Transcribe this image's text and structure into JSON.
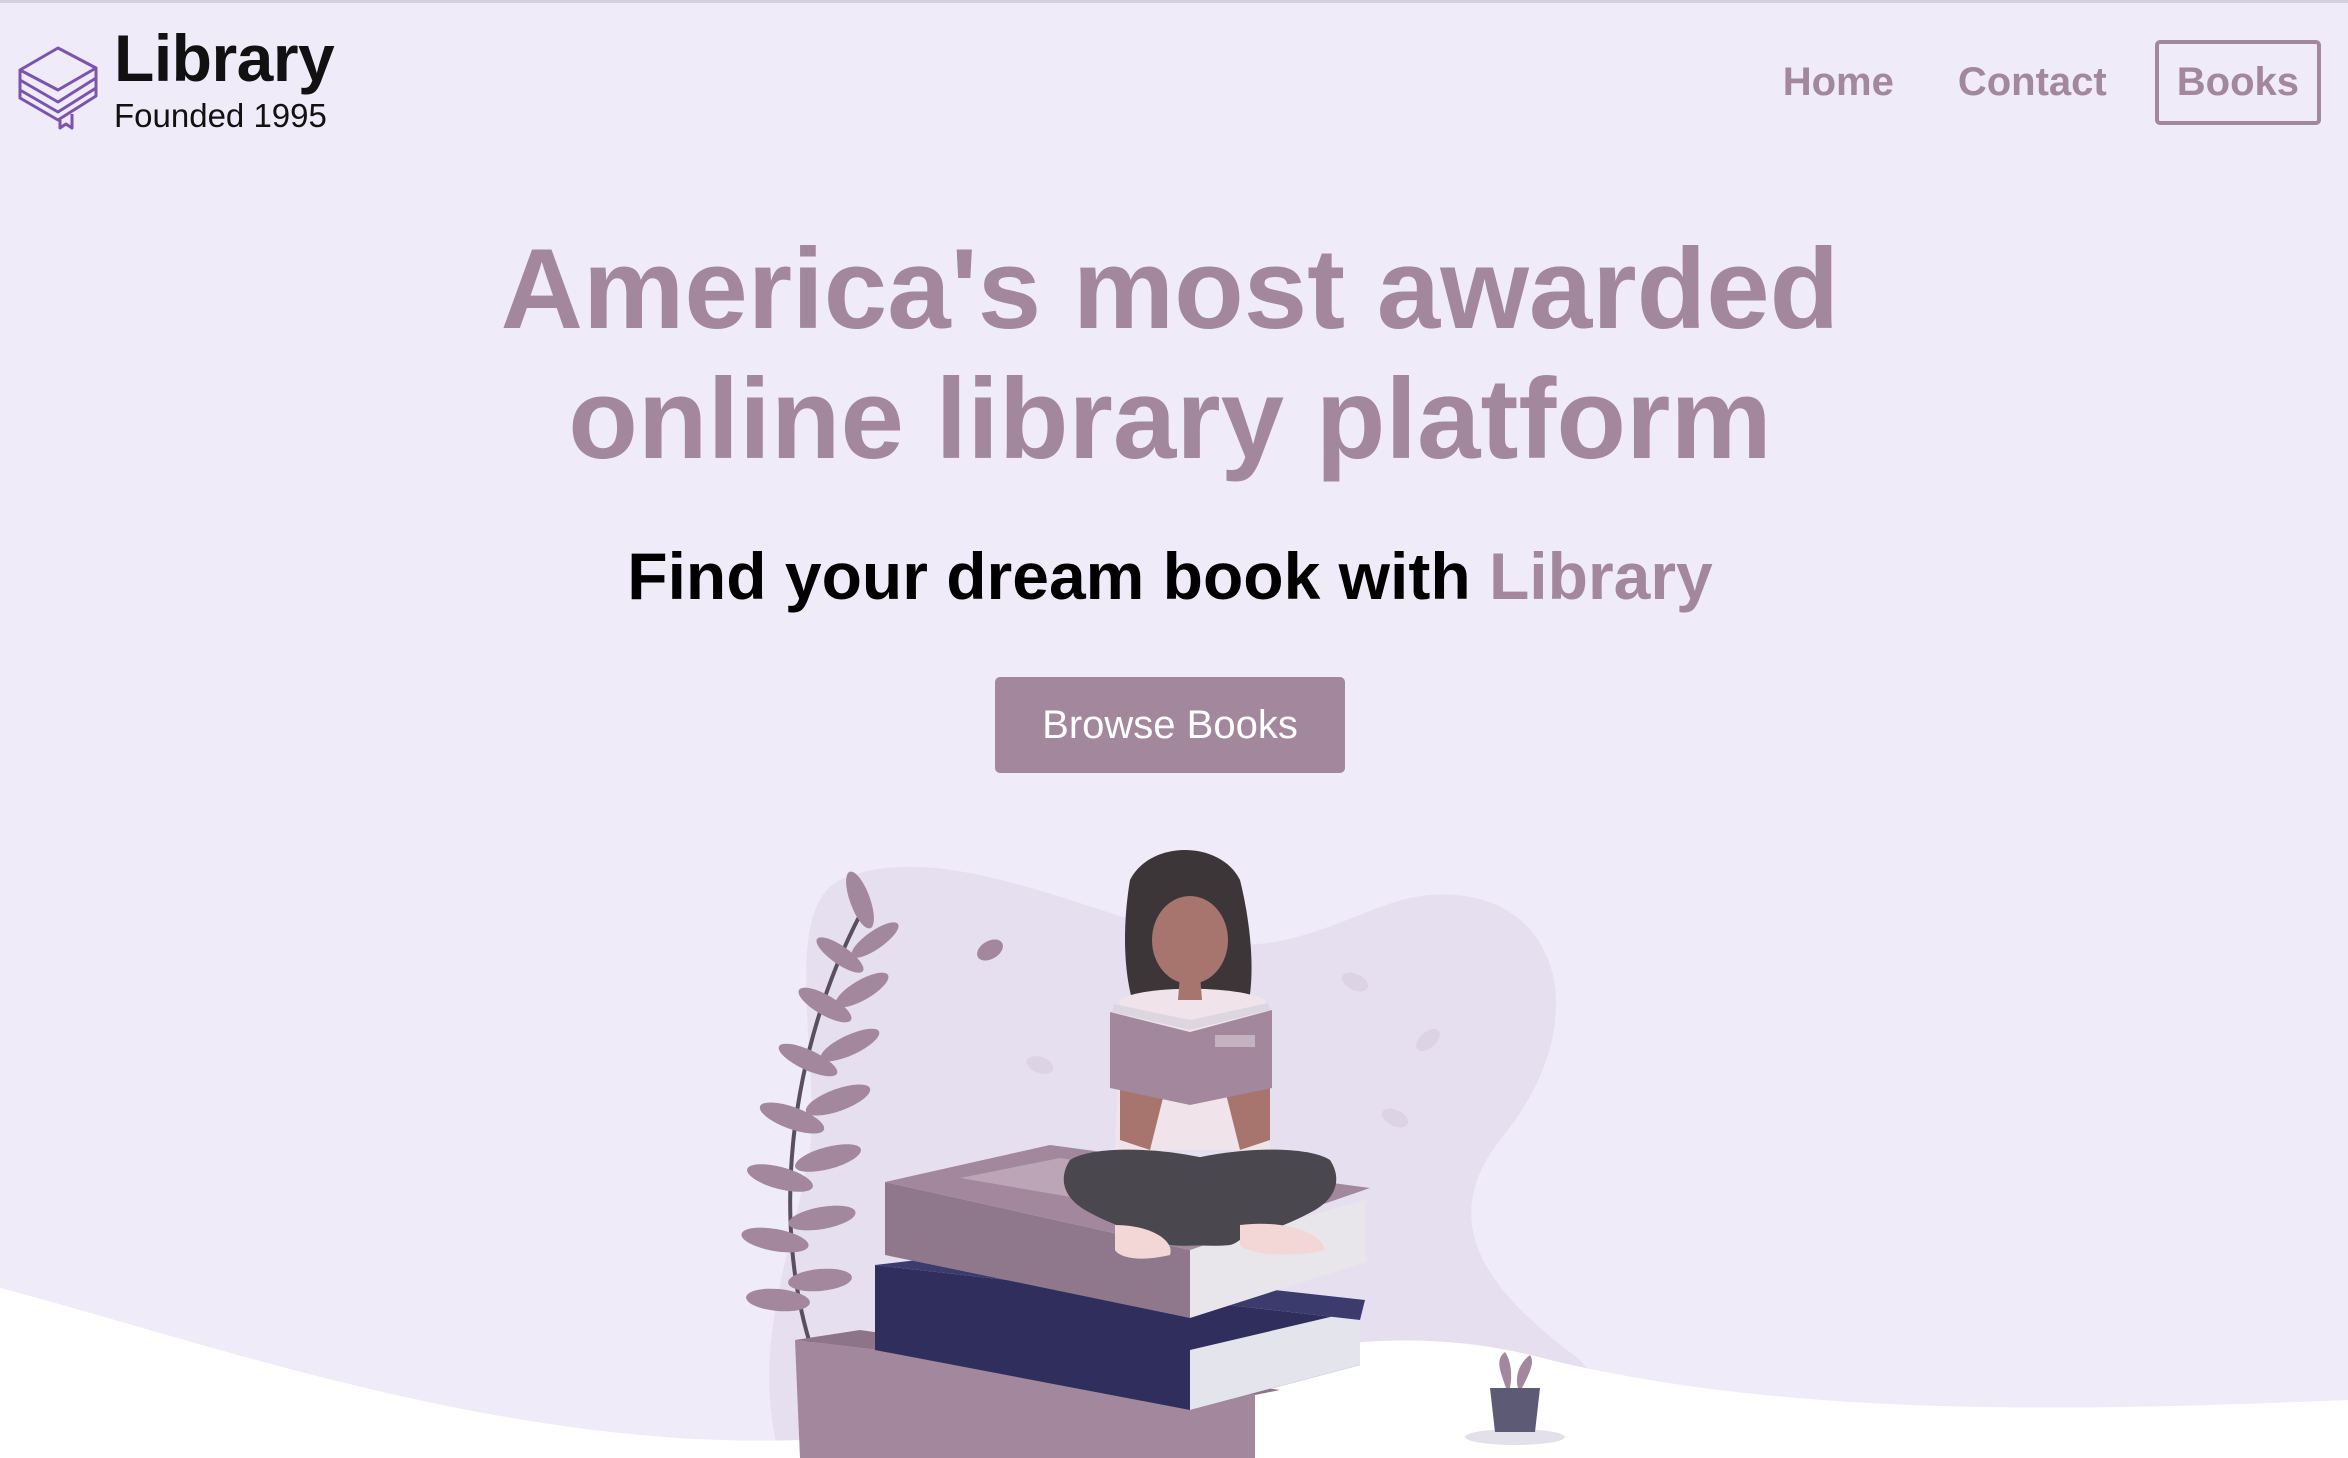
{
  "header": {
    "logo": {
      "title": "Library",
      "subtitle": "Founded 1995",
      "icon": "stacked-books-icon"
    },
    "nav": {
      "home": "Home",
      "contact": "Contact",
      "books": "Books"
    }
  },
  "hero": {
    "title_line1": "America's most awarded",
    "title_line2": "online library platform",
    "subtitle_prefix": "Find your dream book with ",
    "subtitle_accent": "Library",
    "cta_label": "Browse Books",
    "illustration": "woman-reading-on-book-stack"
  },
  "colors": {
    "background": "#f0ebf8",
    "accent": "#a2879d",
    "text": "#000000",
    "book_navy": "#2f2e5c"
  }
}
